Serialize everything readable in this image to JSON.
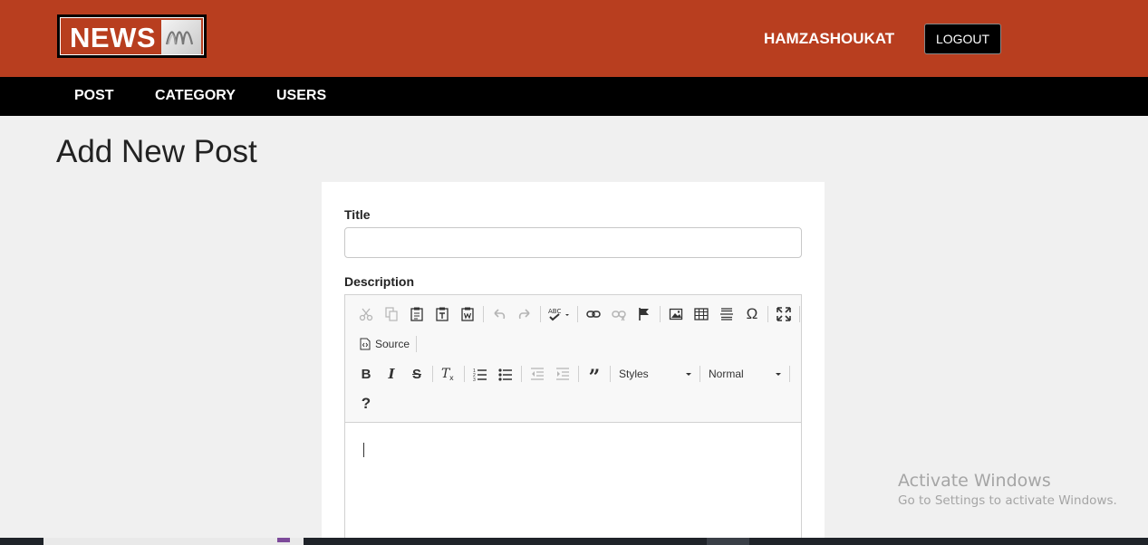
{
  "header": {
    "logo_text": "NEWS",
    "username": "HAMZASHOUKAT",
    "logout_label": "LOGOUT"
  },
  "nav": {
    "items": [
      {
        "label": "POST"
      },
      {
        "label": "CATEGORY"
      },
      {
        "label": "USERS"
      }
    ]
  },
  "page": {
    "title": "Add New Post"
  },
  "form": {
    "title_label": "Title",
    "title_value": "",
    "description_label": "Description"
  },
  "editor": {
    "source_label": "Source",
    "styles_label": "Styles",
    "format_label": "Normal",
    "icons": {
      "row1": [
        "cut-icon",
        "copy-icon",
        "paste-icon",
        "paste-text-icon",
        "paste-word-icon",
        "undo-icon",
        "redo-icon",
        "spellcheck-icon",
        "link-icon",
        "unlink-icon",
        "anchor-icon",
        "image-icon",
        "table-icon",
        "horizontal-line-icon",
        "special-char-icon",
        "maximize-icon"
      ],
      "row3": [
        "bold-icon",
        "italic-icon",
        "strike-icon",
        "remove-format-icon",
        "numbered-list-icon",
        "bulleted-list-icon",
        "outdent-icon",
        "indent-icon",
        "blockquote-icon"
      ],
      "row4": [
        "help-icon"
      ]
    }
  },
  "watermark": {
    "title": "Activate Windows",
    "subtitle": "Go to Settings to activate Windows."
  },
  "colors": {
    "header_bg": "#b83e1f",
    "nav_bg": "#000000",
    "page_bg": "#f0f0f0"
  }
}
